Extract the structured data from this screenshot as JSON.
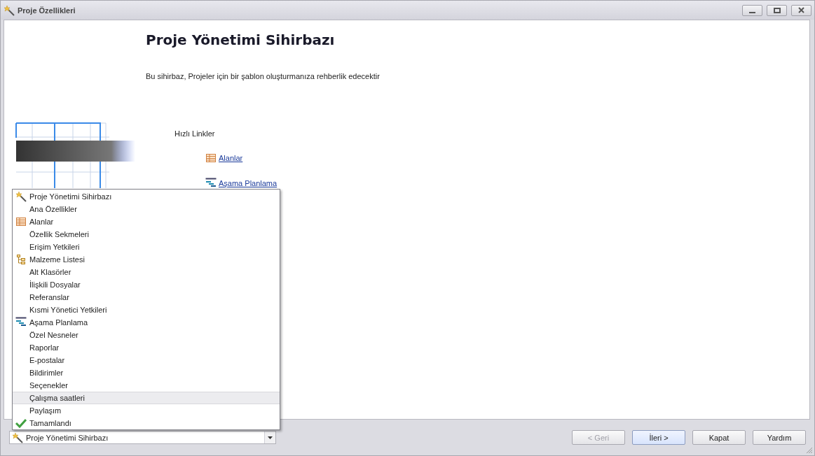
{
  "window": {
    "title": "Proje Özellikleri"
  },
  "wizard": {
    "heading": "Proje Yönetimi Sihirbazı",
    "description": "Bu sihirbaz, Projeler için bir şablon oluşturmanıza rehberlik edecektir",
    "quick_links_label": "Hızlı Linkler",
    "quick_links": [
      {
        "label": "Alanlar",
        "kind": "table"
      },
      {
        "label": "Aşama Planlama",
        "kind": "gantt"
      }
    ]
  },
  "step_list": [
    {
      "label": "Proje Yönetimi Sihirbazı",
      "kind": "wand",
      "selected": false
    },
    {
      "label": "Ana Özellikler",
      "kind": "none",
      "selected": false
    },
    {
      "label": "Alanlar",
      "kind": "table",
      "selected": false
    },
    {
      "label": "Özellik Sekmeleri",
      "kind": "none",
      "selected": false
    },
    {
      "label": "Erişim Yetkileri",
      "kind": "none",
      "selected": false
    },
    {
      "label": "Malzeme Listesi",
      "kind": "tree",
      "selected": false
    },
    {
      "label": "Alt Klasörler",
      "kind": "none",
      "selected": false
    },
    {
      "label": "İlişkili Dosyalar",
      "kind": "none",
      "selected": false
    },
    {
      "label": "Referanslar",
      "kind": "none",
      "selected": false
    },
    {
      "label": "Kısmi Yönetici Yetkileri",
      "kind": "none",
      "selected": false
    },
    {
      "label": "Aşama Planlama",
      "kind": "gantt",
      "selected": false
    },
    {
      "label": "Özel Nesneler",
      "kind": "none",
      "selected": false
    },
    {
      "label": "Raporlar",
      "kind": "none",
      "selected": false
    },
    {
      "label": "E-postalar",
      "kind": "none",
      "selected": false
    },
    {
      "label": "Bildirimler",
      "kind": "none",
      "selected": false
    },
    {
      "label": "Seçenekler",
      "kind": "none",
      "selected": false
    },
    {
      "label": "Çalışma saatleri",
      "kind": "none",
      "selected": true
    },
    {
      "label": "Paylaşım",
      "kind": "none",
      "selected": false
    },
    {
      "label": "Tamamlandı",
      "kind": "check",
      "selected": false
    }
  ],
  "step_combo": {
    "value": "Proje Yönetimi Sihirbazı",
    "kind": "wand"
  },
  "buttons": [
    {
      "label": "< Geri",
      "disabled": true,
      "default": false
    },
    {
      "label": "İleri >",
      "disabled": false,
      "default": true
    },
    {
      "label": "Kapat",
      "disabled": false,
      "default": false
    },
    {
      "label": "Yardım",
      "disabled": false,
      "default": false
    }
  ]
}
